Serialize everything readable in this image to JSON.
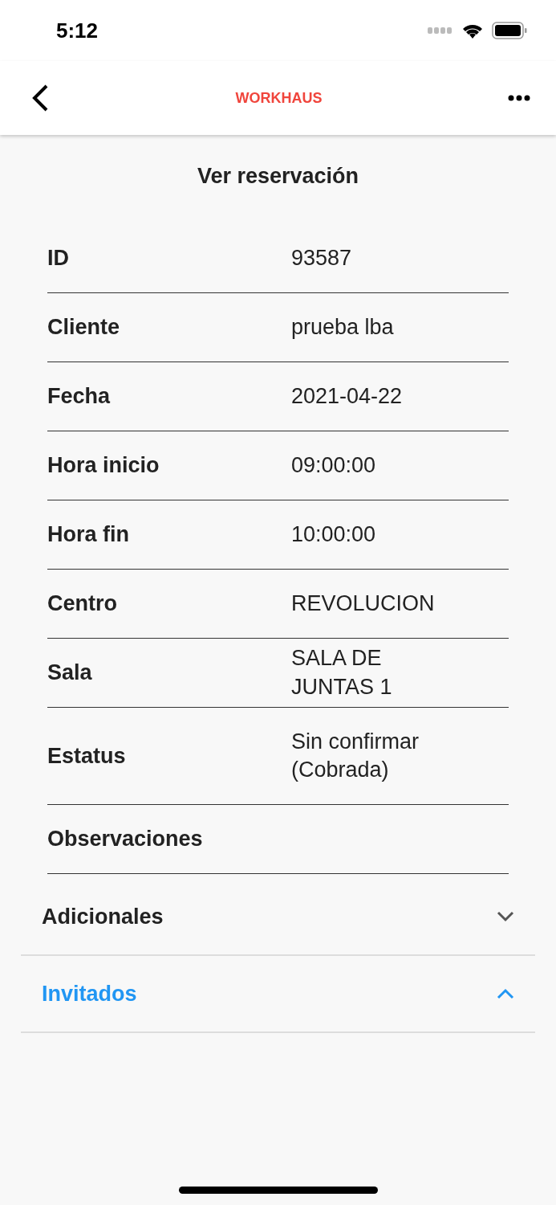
{
  "status_bar": {
    "time": "5:12"
  },
  "nav_bar": {
    "logo": "WORKHAUS"
  },
  "title": "Ver reservación",
  "fields": [
    {
      "label": "ID",
      "value": "93587"
    },
    {
      "label": "Cliente",
      "value": "prueba lba"
    },
    {
      "label": "Fecha",
      "value": "2021-04-22"
    },
    {
      "label": "Hora inicio",
      "value": "09:00:00"
    },
    {
      "label": "Hora fin",
      "value": "10:00:00"
    },
    {
      "label": "Centro",
      "value": "REVOLUCION"
    },
    {
      "label": "Sala",
      "value": "SALA DE JUNTAS 1"
    },
    {
      "label": "Estatus",
      "value": "Sin confirmar (Cobrada)"
    },
    {
      "label": "Observaciones"
    }
  ],
  "sections": [
    {
      "label": "Adicionales",
      "expanded": false
    },
    {
      "label": "Invitados",
      "expanded": true
    }
  ]
}
